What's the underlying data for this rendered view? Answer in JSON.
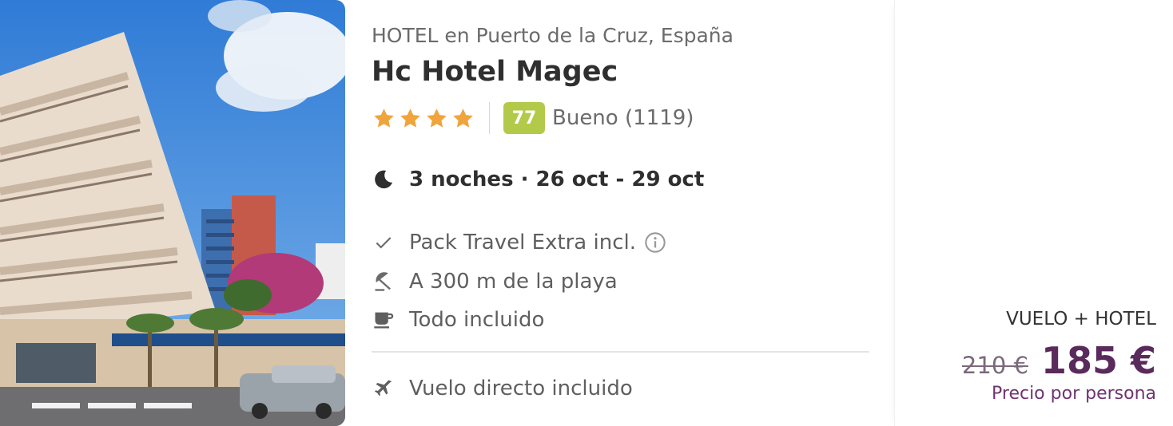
{
  "hotel": {
    "kicker": "HOTEL en Puerto de la Cruz, España",
    "name": "Hc Hotel Magec",
    "stars": 4,
    "score": "77",
    "score_text": "Bueno (1119)"
  },
  "stay": {
    "summary": "3 noches · 26 oct - 29 oct"
  },
  "features": [
    {
      "icon": "check-icon",
      "label": "Pack Travel Extra incl."
    },
    {
      "icon": "beach-umbrella-icon",
      "label": "A 300 m de la playa"
    },
    {
      "icon": "coffee-cup-icon",
      "label": "Todo incluido"
    }
  ],
  "flight": {
    "icon": "airplane-icon",
    "label": "Vuelo directo incluido"
  },
  "price": {
    "type": "VUELO + HOTEL",
    "old": "210 €",
    "new": "185 €",
    "note": "Precio por persona"
  },
  "colors": {
    "star": "#f0a43c",
    "score_badge": "#b3c94a",
    "price_accent": "#5a2a5c"
  }
}
